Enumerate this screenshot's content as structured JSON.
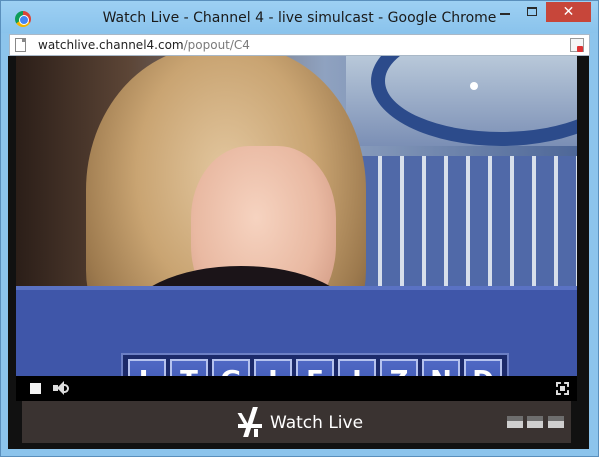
{
  "window": {
    "title": "Watch Live - Channel 4 - live simulcast - Google Chrome",
    "close_glyph": "✕"
  },
  "address": {
    "host": "watchlive.channel4.com",
    "path": "/popout/C4"
  },
  "board": {
    "letters": [
      "L",
      "T",
      "G",
      "I",
      "E",
      "I",
      "Z",
      "N",
      "D"
    ]
  },
  "player": {
    "footer_label": "Watch Live"
  },
  "icons": {
    "app": "chrome-icon",
    "page": "page-icon",
    "page_action": "page-action-icon",
    "stop": "stop-icon",
    "volume": "volume-icon",
    "fullscreen": "fullscreen-icon",
    "logo": "channel4-logo-icon"
  },
  "colors": {
    "titlebar": "#8ac3ec",
    "close": "#c7463a",
    "board": "#3a53ad",
    "footer": "#3a3331"
  }
}
